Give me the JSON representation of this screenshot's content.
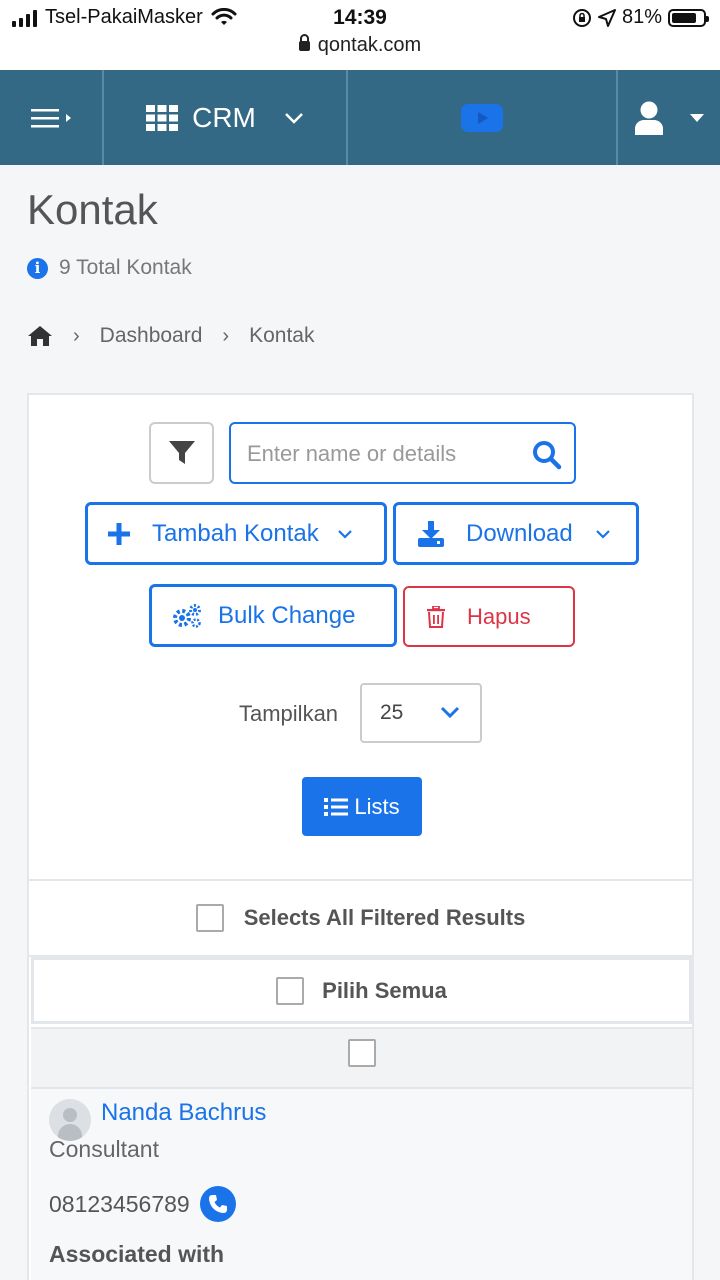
{
  "status_bar": {
    "carrier": "Tsel-PakaiMasker",
    "time": "14:39",
    "battery": "81%",
    "battery_level": 0.81,
    "url": "qontak.com"
  },
  "navbar": {
    "app_name": "CRM"
  },
  "page": {
    "title": "Kontak",
    "total": "9 Total Kontak"
  },
  "breadcrumb": {
    "items": [
      "Dashboard",
      "Kontak"
    ]
  },
  "toolbar": {
    "search_placeholder": "Enter name or details",
    "search_value": "",
    "add_label": "Tambah Kontak",
    "download_label": "Download",
    "bulk_label": "Bulk Change",
    "delete_label": "Hapus",
    "show_label": "Tampilkan",
    "show_value": "25",
    "lists_label": "Lists"
  },
  "selection": {
    "select_all_filtered": "Selects All Filtered Results",
    "select_all": "Pilih Semua"
  },
  "contacts": [
    {
      "name": "Nanda Bachrus",
      "job_title": "Consultant",
      "phone": "08123456789",
      "associated_label": "Associated with"
    }
  ],
  "colors": {
    "navbar": "#346985",
    "primary": "#1a73e8",
    "danger": "#dc3545"
  },
  "icons": [
    "menu-icon",
    "grid-icon",
    "chevron-down-icon",
    "play-icon",
    "user-icon",
    "info-icon",
    "home-icon",
    "filter-icon",
    "search-icon",
    "plus-icon",
    "download-icon",
    "cogs-icon",
    "trash-icon",
    "list-icon",
    "phone-icon"
  ]
}
